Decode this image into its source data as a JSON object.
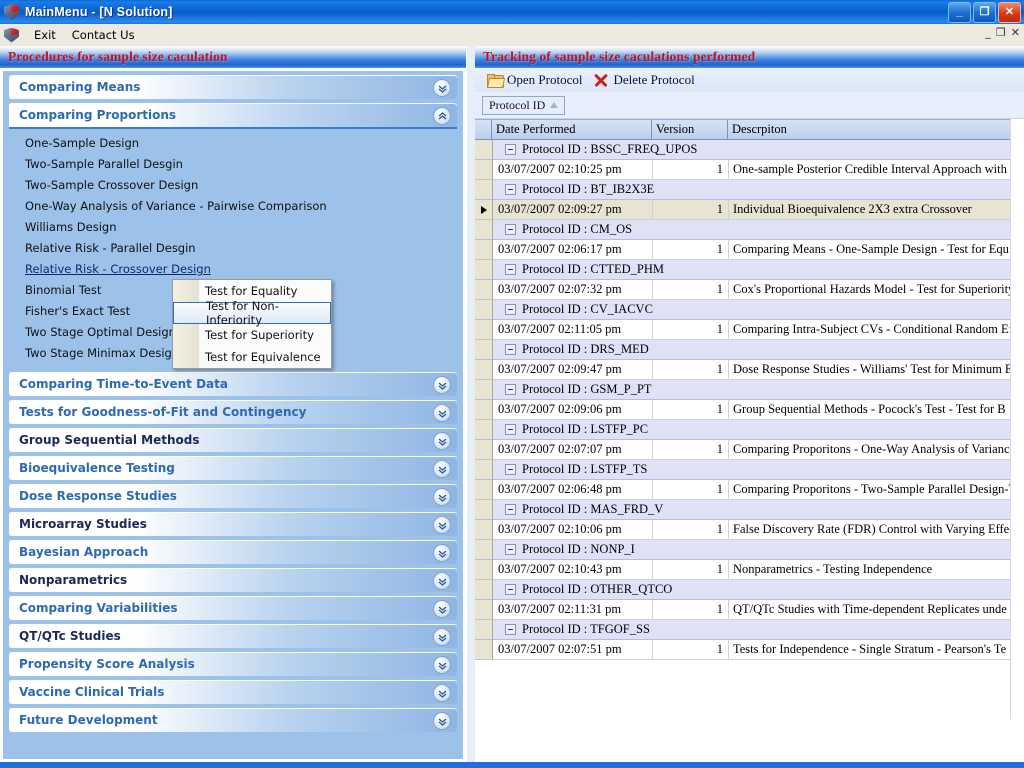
{
  "window": {
    "title": "MainMenu  - [N Solution]",
    "icon": "app-shield-icon",
    "buttons": {
      "minimize": "_",
      "maximize": "❐",
      "close": "✕"
    },
    "mdi_buttons": {
      "minimize": "_",
      "restore": "❐",
      "close": "✕"
    }
  },
  "menubar": {
    "items": [
      "Exit",
      "Contact Us"
    ]
  },
  "left_panel": {
    "title": "Procedures for sample size caculation",
    "sections": [
      {
        "label": "Comparing Means",
        "expanded": false,
        "dark": false,
        "items": []
      },
      {
        "label": "Comparing Proportions",
        "expanded": true,
        "dark": false,
        "items": [
          "One-Sample Design",
          "Two-Sample Parallel Desgin",
          "Two-Sample Crossover Design",
          "One-Way Analysis of Variance - Pairwise Comparison",
          "Williams Design",
          "Relative Risk - Parallel Desgin",
          "Relative Risk - Crossover Design",
          "Binomial Test",
          "Fisher's Exact Test",
          "Two Stage Optimal Design",
          "Two Stage Minimax Design"
        ],
        "selected_item": "Relative Risk - Crossover Design"
      },
      {
        "label": "Comparing Time-to-Event Data",
        "expanded": false,
        "dark": false,
        "items": []
      },
      {
        "label": "Tests for Goodness-of-Fit and Contingency",
        "expanded": false,
        "dark": false,
        "items": []
      },
      {
        "label": "Group Sequential Methods",
        "expanded": false,
        "dark": true,
        "items": []
      },
      {
        "label": "Bioequivalence Testing",
        "expanded": false,
        "dark": false,
        "items": []
      },
      {
        "label": "Dose Response Studies",
        "expanded": false,
        "dark": false,
        "items": []
      },
      {
        "label": "Microarray Studies",
        "expanded": false,
        "dark": true,
        "items": []
      },
      {
        "label": "Bayesian Approach",
        "expanded": false,
        "dark": false,
        "items": []
      },
      {
        "label": "Nonparametrics",
        "expanded": false,
        "dark": true,
        "items": []
      },
      {
        "label": "Comparing Variabilities",
        "expanded": false,
        "dark": false,
        "items": []
      },
      {
        "label": "QT/QTc Studies",
        "expanded": false,
        "dark": true,
        "items": []
      },
      {
        "label": "Propensity Score Analysis",
        "expanded": false,
        "dark": false,
        "items": []
      },
      {
        "label": "Vaccine Clinical Trials",
        "expanded": false,
        "dark": false,
        "items": []
      },
      {
        "label": "Future Development",
        "expanded": false,
        "dark": false,
        "items": []
      }
    ]
  },
  "context_menu": {
    "visible": true,
    "highlighted": "Test for Non-Inferiority",
    "items": [
      "Test for Equality",
      "Test for Non-Inferiority",
      "Test for Superiority",
      "Test for Equivalence"
    ]
  },
  "right_panel": {
    "title": "Tracking of sample size caculations performed",
    "toolbar": [
      {
        "label": "Open Protocol",
        "icon": "folder-open-icon"
      },
      {
        "label": "Delete Protocol",
        "icon": "x-delete-icon"
      }
    ],
    "group_by": {
      "field": "Protocol ID",
      "sort": "ascending",
      "sort_glyph": "△"
    },
    "grid": {
      "columns": [
        "Date Performed",
        "Version",
        "Descrpiton"
      ],
      "group_label_prefix": "Protocol ID : ",
      "selected_group": "BT_IB2X3E",
      "groups": [
        {
          "id": "BSSC_FREQ_UPOS",
          "expanded": true,
          "rows": [
            {
              "date": "03/07/2007 02:10:25 pm",
              "version": "1",
              "description": "One-sample Posterior Credible Interval Approach with",
              "selected": false
            }
          ]
        },
        {
          "id": "BT_IB2X3E",
          "expanded": true,
          "rows": [
            {
              "date": "03/07/2007 02:09:27 pm",
              "version": "1",
              "description": "Individual Bioequivalence 2X3 extra Crossover",
              "selected": true
            }
          ]
        },
        {
          "id": "CM_OS",
          "expanded": true,
          "rows": [
            {
              "date": "03/07/2007 02:06:17 pm",
              "version": "1",
              "description": "Comparing Means - One-Sample Design - Test for Equ",
              "selected": false
            }
          ]
        },
        {
          "id": "CTTED_PHM",
          "expanded": true,
          "rows": [
            {
              "date": "03/07/2007 02:07:32 pm",
              "version": "1",
              "description": "Cox's Proportional Hazards Model - Test for Superiority",
              "selected": false
            }
          ]
        },
        {
          "id": "CV_IACVC",
          "expanded": true,
          "rows": [
            {
              "date": "03/07/2007 02:11:05 pm",
              "version": "1",
              "description": "Comparing Intra-Subject CVs - Conditional Random Eff",
              "selected": false
            }
          ]
        },
        {
          "id": "DRS_MED",
          "expanded": true,
          "rows": [
            {
              "date": "03/07/2007 02:09:47 pm",
              "version": "1",
              "description": "Dose Response Studies - Williams' Test for Minimum E",
              "selected": false
            }
          ]
        },
        {
          "id": "GSM_P_PT",
          "expanded": true,
          "rows": [
            {
              "date": "03/07/2007 02:09:06 pm",
              "version": "1",
              "description": "Group Sequential Methods - Pocock's Test - Test for B",
              "selected": false
            }
          ]
        },
        {
          "id": "LSTFP_PC",
          "expanded": true,
          "rows": [
            {
              "date": "03/07/2007 02:07:07 pm",
              "version": "1",
              "description": "Comparing Proporitons - One-Way Analysis of Varianc",
              "selected": false
            }
          ]
        },
        {
          "id": "LSTFP_TS",
          "expanded": true,
          "rows": [
            {
              "date": "03/07/2007 02:06:48 pm",
              "version": "1",
              "description": "Comparing Proporitons - Two-Sample Parallel Design-T",
              "selected": false
            }
          ]
        },
        {
          "id": "MAS_FRD_V",
          "expanded": true,
          "rows": [
            {
              "date": "03/07/2007 02:10:06 pm",
              "version": "1",
              "description": "False Discovery Rate (FDR) Control with Varying Effec",
              "selected": false
            }
          ]
        },
        {
          "id": "NONP_I",
          "expanded": true,
          "rows": [
            {
              "date": "03/07/2007 02:10:43 pm",
              "version": "1",
              "description": "Nonparametrics - Testing Independence",
              "selected": false
            }
          ]
        },
        {
          "id": "OTHER_QTCO",
          "expanded": true,
          "rows": [
            {
              "date": "03/07/2007 02:11:31 pm",
              "version": "1",
              "description": "QT/QTc Studies with Time-dependent Replicates unde",
              "selected": false
            }
          ]
        },
        {
          "id": "TFGOF_SS",
          "expanded": true,
          "rows": [
            {
              "date": "03/07/2007 02:07:51 pm",
              "version": "1",
              "description": "Tests for Independence - Single Stratum - Pearson's Te",
              "selected": false
            }
          ]
        }
      ]
    }
  },
  "colors": {
    "title_blue": "#0b63d4",
    "panel_title_red": "#c1121f",
    "nav_body_blue": "#9cc2ea",
    "group_row": "#dfe1f7",
    "selected_row": "#e8e4d2",
    "accordion_label": "#2d6ab0"
  }
}
